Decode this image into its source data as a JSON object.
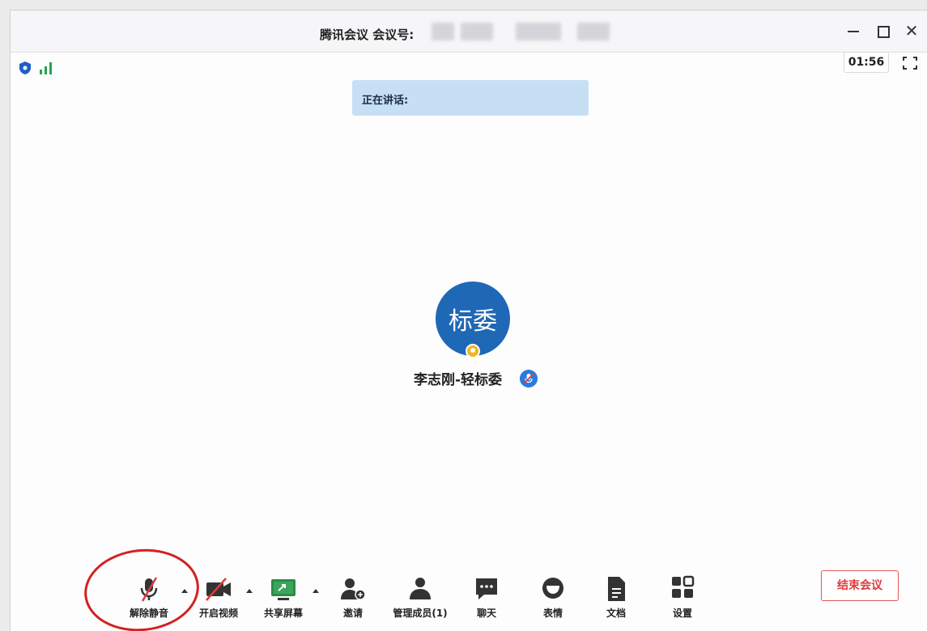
{
  "window": {
    "title": "腾讯会议 会议号:",
    "timer": "01:56"
  },
  "speaking": {
    "label": "正在讲话:"
  },
  "participant": {
    "avatar_text": "标委",
    "name": "李志刚-轻标委"
  },
  "toolbar": {
    "unmute": "解除静音",
    "start_video": "开启视频",
    "share_screen": "共享屏幕",
    "invite": "邀请",
    "manage_members": "管理成员(1)",
    "chat": "聊天",
    "reactions": "表情",
    "documents": "文档",
    "settings": "设置",
    "end_meeting": "结束会议"
  },
  "icons": {
    "shield": "shield-icon",
    "signal": "signal-icon",
    "fullscreen": "fullscreen-icon",
    "mic_muted": "mic-muted-icon",
    "camera_off": "camera-off-icon",
    "share_screen": "screen-share-icon",
    "invite": "add-user-icon",
    "members": "members-icon",
    "chat": "chat-icon",
    "reactions": "smile-icon",
    "documents": "document-icon",
    "settings": "grid-icon"
  },
  "colors": {
    "avatar": "#1f68b6",
    "speaking_bar": "#c6dff5",
    "end_meeting": "#e03a3a",
    "signal": "#22a64a",
    "annotation": "#d42020"
  }
}
